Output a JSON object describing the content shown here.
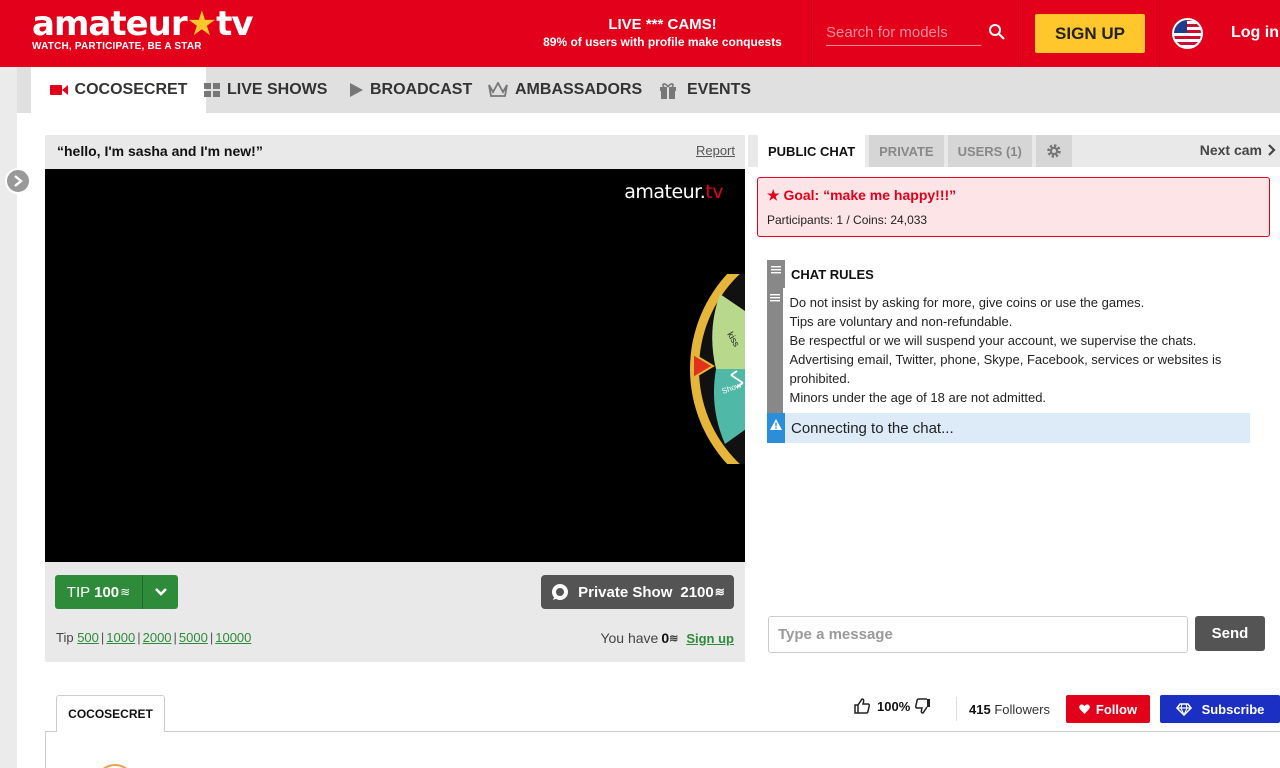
{
  "header": {
    "logo_text": "amateur.tv",
    "tagline": "WATCH, PARTICIPATE, BE A STAR",
    "promo_title": "LIVE *** CAMS!",
    "promo_subtitle": "89% of users with profile make conquests",
    "search_placeholder": "Search for models",
    "signup_label": "SIGN UP",
    "login_label": "Log in",
    "brand_color": "#e2001a"
  },
  "nav": {
    "items": [
      {
        "label": "COCOSECRET",
        "icon": "camera-icon",
        "active": true
      },
      {
        "label": "LIVE SHOWS",
        "icon": "grid-icon"
      },
      {
        "label": "BROADCAST",
        "icon": "play-icon"
      },
      {
        "label": "AMBASSADORS",
        "icon": "crown-icon"
      },
      {
        "label": "EVENTS",
        "icon": "gift-icon"
      }
    ]
  },
  "player": {
    "title": "“hello, I'm sasha and I'm new!”",
    "report_label": "Report",
    "watermark_main": "amateur.",
    "watermark_tv": "tv",
    "wheel_labels": [
      "kiss",
      "Show"
    ],
    "tip_label": "TIP",
    "tip_amount": "100",
    "private_label": "Private Show",
    "private_price": "2100",
    "tip_prefix": "Tip",
    "tip_amounts": [
      "500",
      "1000",
      "2000",
      "5000",
      "10000"
    ],
    "you_have_label": "You have",
    "coins_balance": "0",
    "signup_link": "Sign up"
  },
  "chat": {
    "tabs": [
      "PUBLIC CHAT",
      "PRIVATE",
      "USERS (1)"
    ],
    "next_cam_label": "Next cam",
    "goal_title": "★ Goal: “make me happy!!!”",
    "goal_stats": "Participants: 1 / Coins: 24,033",
    "rules_title": "CHAT RULES",
    "rules_lines": [
      "Do not insist by asking for more, give coins or use the games.",
      "Tips are voluntary and non-refundable.",
      "Be respectful or we will suspend your account, we supervise the chats.",
      "Advertising email, Twitter, phone, Skype, Facebook, services or websites is prohibited.",
      "Minors under the age of 18 are not admitted."
    ],
    "connecting_text": "Connecting to the chat...",
    "input_placeholder": "Type a message",
    "send_label": "Send"
  },
  "profile": {
    "tab_label": "COCOSECRET",
    "rating": "100%",
    "followers_count": "415",
    "followers_label": "Followers",
    "follow_label": "Follow",
    "subscribe_label": "Subscribe"
  }
}
